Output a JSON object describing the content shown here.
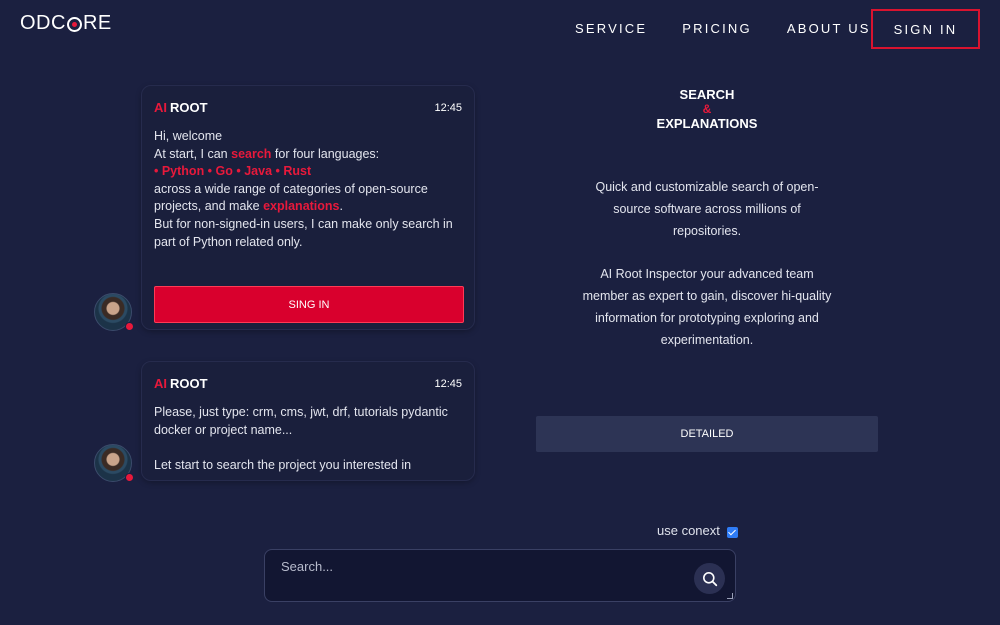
{
  "header": {
    "logo_prefix": "ODC",
    "logo_suffix": "RE",
    "nav": [
      {
        "label": "SERVICE"
      },
      {
        "label": "PRICING"
      },
      {
        "label": "ABOUT US"
      }
    ],
    "signin_label": "SIGN IN"
  },
  "chat": {
    "messages": [
      {
        "sender_prefix": "AI",
        "sender_name": "ROOT",
        "time": "12:45",
        "greeting": "Hi, welcome",
        "line2_pre": "At start, I can ",
        "line2_hl": "search",
        "line2_post": " for four languages:",
        "languages": "• Python • Go • Java • Rust",
        "line4": "across a wide range of categories of open-source",
        "line5_pre": "projects, and make ",
        "line5_hl": "explanations",
        "line5_post": ".",
        "line6": "But for non-signed-in users, I can make only search in part of Python related only.",
        "button_label": "SING IN"
      },
      {
        "sender_prefix": "AI",
        "sender_name": "ROOT",
        "time": "12:45",
        "text1": "Please, just type: crm, cms, jwt, drf, tutorials pydantic docker or project name...",
        "text2": "Let start to search the project you interested in"
      }
    ]
  },
  "info": {
    "title_line1": "SEARCH",
    "title_amp": "&",
    "title_line2": "EXPLANATIONS",
    "paragraph1": "Quick and customizable search of open-source software across millions of repositories.",
    "paragraph2": "AI Root Inspector your advanced team member as expert to gain, discover hi-quality information for prototyping exploring and experimentation.",
    "detailed_label": "DETAILED"
  },
  "search": {
    "context_label": "use conext",
    "context_checked": true,
    "placeholder": "Search...",
    "icon": "search-icon"
  },
  "colors": {
    "background": "#1b2040",
    "accent": "#e8193b",
    "card": "#1a1f3c",
    "button_dark": "#2d3455"
  }
}
